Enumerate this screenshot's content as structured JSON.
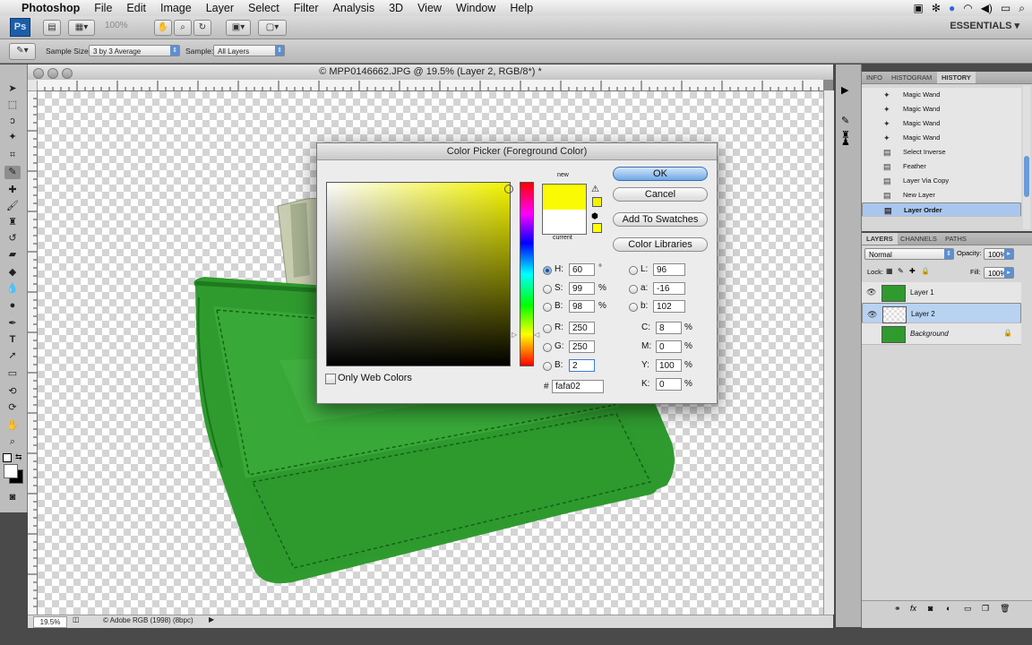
{
  "menubar": {
    "app_name": "Photoshop",
    "items": [
      "File",
      "Edit",
      "Image",
      "Layer",
      "Select",
      "Filter",
      "Analysis",
      "3D",
      "View",
      "Window",
      "Help"
    ],
    "status_icons": [
      "ps-icon",
      "bluetooth-icon",
      "sync-icon",
      "wifi-icon",
      "volume-icon",
      "battery-icon",
      "search-icon"
    ]
  },
  "appbar": {
    "ps_logo": "Ps",
    "zoom": "100%",
    "workspace": "ESSENTIALS ▾"
  },
  "options": {
    "sample_size_label": "Sample Size:",
    "sample_size_value": "3 by 3 Average",
    "sample_label": "Sample:",
    "sample_value": "All Layers"
  },
  "document": {
    "title": "© MPP0146662.JPG @ 19.5% (Layer 2, RGB/8*) *",
    "zoom": "19.5%",
    "profile": "© Adobe RGB (1998) (8bpc)"
  },
  "color_picker": {
    "title": "Color Picker (Foreground Color)",
    "new_label": "new",
    "current_label": "current",
    "new_color": "#fafa02",
    "current_color": "#ffffff",
    "buttons": {
      "ok": "OK",
      "cancel": "Cancel",
      "add_swatches": "Add To Swatches",
      "color_libraries": "Color Libraries"
    },
    "hsb": {
      "h_label": "H:",
      "h": "60",
      "h_unit": "°",
      "s_label": "S:",
      "s": "99",
      "s_unit": "%",
      "b_label": "B:",
      "b": "98",
      "b_unit": "%"
    },
    "rgb": {
      "r_label": "R:",
      "r": "250",
      "g_label": "G:",
      "g": "250",
      "b_label": "B:",
      "b": "2"
    },
    "lab": {
      "l_label": "L:",
      "l": "96",
      "a_label": "a:",
      "a": "-16",
      "b_label": "b:",
      "b": "102"
    },
    "cmyk": {
      "c_label": "C:",
      "c": "8",
      "c_unit": "%",
      "m_label": "M:",
      "m": "0",
      "m_unit": "%",
      "y_label": "Y:",
      "y": "100",
      "y_unit": "%",
      "k_label": "K:",
      "k": "0",
      "k_unit": "%"
    },
    "hex_label": "#",
    "hex": "fafa02",
    "web_colors_label": "Only Web Colors"
  },
  "history": {
    "tabs": [
      "INFO",
      "HISTORY"
    ],
    "tab_histogram": "HISTOGRAM",
    "items": [
      {
        "label": "Magic Wand",
        "selected": false
      },
      {
        "label": "Magic Wand",
        "selected": false
      },
      {
        "label": "Magic Wand",
        "selected": false
      },
      {
        "label": "Magic Wand",
        "selected": false
      },
      {
        "label": "Select Inverse",
        "selected": false
      },
      {
        "label": "Feather",
        "selected": false
      },
      {
        "label": "Layer Via Copy",
        "selected": false
      },
      {
        "label": "New Layer",
        "selected": false
      },
      {
        "label": "Layer Order",
        "selected": true
      }
    ]
  },
  "layers": {
    "tabs": [
      "LAYERS",
      "CHANNELS",
      "PATHS"
    ],
    "blend_mode": "Normal",
    "opacity_label": "Opacity:",
    "opacity": "100%",
    "lock_label": "Lock:",
    "fill_label": "Fill:",
    "fill": "100%",
    "items": [
      {
        "name": "Layer 1",
        "selected": false
      },
      {
        "name": "Layer 2",
        "selected": true
      },
      {
        "name": "Background",
        "selected": false
      }
    ]
  }
}
